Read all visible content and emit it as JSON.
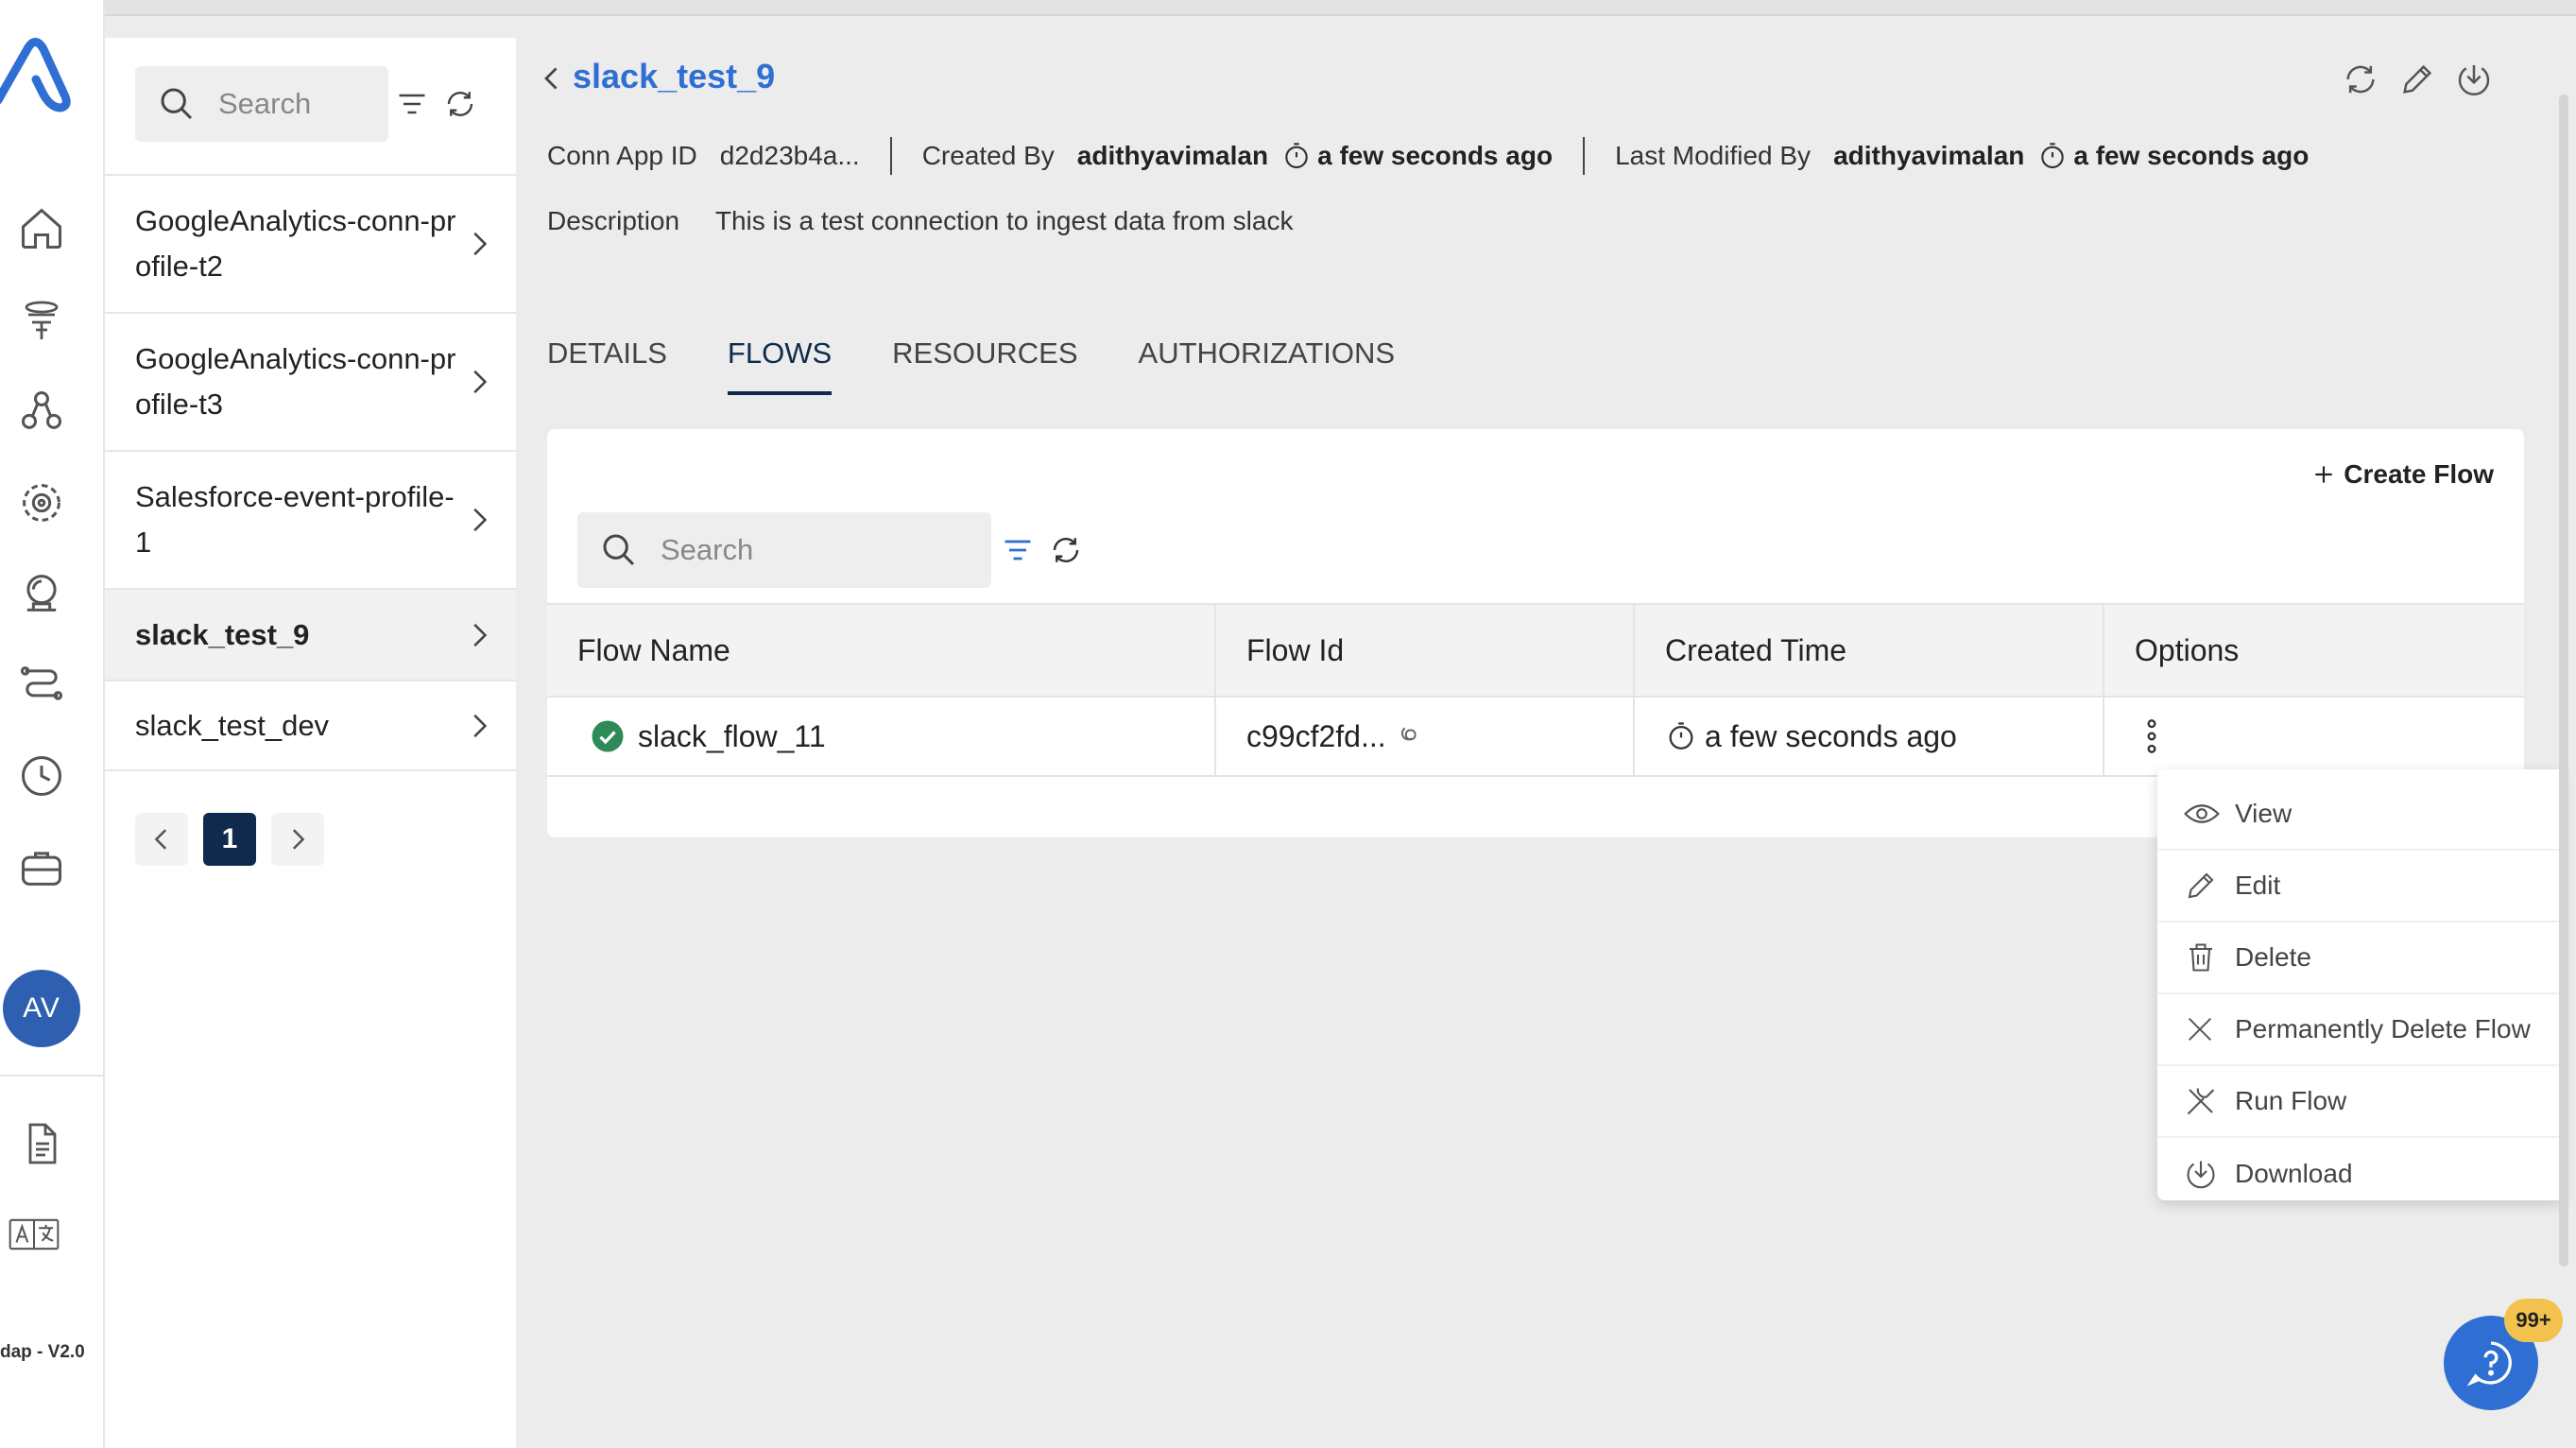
{
  "app": {
    "version": "dap - V2.0",
    "user_initials": "AV"
  },
  "list_panel": {
    "search_placeholder": "Search",
    "items": [
      {
        "line1": "GoogleAnalytics-conn-pr",
        "line2": "ofile-t2"
      },
      {
        "line1": "GoogleAnalytics-conn-pr",
        "line2": "ofile-t3"
      },
      {
        "line1": "Salesforce-event-profile-",
        "line2": "1"
      },
      {
        "line1": "slack_test_9",
        "line2": ""
      },
      {
        "line1": "slack_test_dev",
        "line2": ""
      }
    ],
    "page": "1"
  },
  "header": {
    "title": "slack_test_9",
    "conn_app_id_label": "Conn App ID",
    "conn_app_id_value": "d2d23b4a...",
    "created_by_label": "Created By",
    "created_by_user": "adithyavimalan",
    "created_time": "a few seconds ago",
    "modified_by_label": "Last Modified By",
    "modified_by_user": "adithyavimalan",
    "modified_time": "a few seconds ago",
    "description_label": "Description",
    "description_value": "This is a test connection to ingest data from slack"
  },
  "tabs": [
    {
      "label": "DETAILS"
    },
    {
      "label": "FLOWS"
    },
    {
      "label": "RESOURCES"
    },
    {
      "label": "AUTHORIZATIONS"
    }
  ],
  "flows": {
    "create_label": "Create Flow",
    "search_placeholder": "Search",
    "columns": [
      "Flow Name",
      "Flow Id",
      "Created Time",
      "Options"
    ],
    "rows": [
      {
        "name": "slack_flow_11",
        "id": "c99cf2fd...",
        "created": "a few seconds ago"
      }
    ]
  },
  "options_menu": [
    {
      "label": "View",
      "icon": "eye-icon"
    },
    {
      "label": "Edit",
      "icon": "pencil-icon"
    },
    {
      "label": "Delete",
      "icon": "trash-icon"
    },
    {
      "label": "Permanently Delete Flow",
      "icon": "close-icon"
    },
    {
      "label": "Run Flow",
      "icon": "tools-icon"
    },
    {
      "label": "Download",
      "icon": "download-icon"
    }
  ],
  "help": {
    "badge": "99+"
  },
  "colors": {
    "accent": "#2f6fd4",
    "dark": "#0f2a4d",
    "success": "#2e8b57",
    "badge": "#f2c14e"
  }
}
